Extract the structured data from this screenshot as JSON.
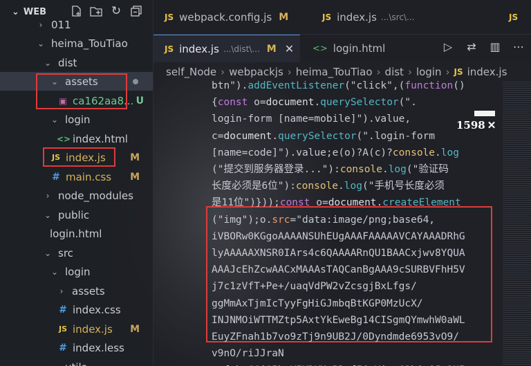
{
  "sidebar": {
    "title": "WEB",
    "tree": [
      {
        "name": "011",
        "chevron": "›",
        "indent": 52,
        "icon": "",
        "status": ""
      },
      {
        "name": "heima_TouTiao",
        "chevron": "⌄",
        "indent": 52,
        "icon": "",
        "status": ""
      },
      {
        "name": "dist",
        "chevron": "⌄",
        "indent": 62,
        "icon": "",
        "status": ""
      },
      {
        "name": "assets",
        "chevron": "⌄",
        "indent": 72,
        "icon": "",
        "status": "dot"
      },
      {
        "name": "ca162aa8...",
        "chevron": "",
        "indent": 82,
        "icon": "img",
        "status": "U"
      },
      {
        "name": "login",
        "chevron": "⌄",
        "indent": 72,
        "icon": "",
        "status": ""
      },
      {
        "name": "index.html",
        "chevron": "",
        "indent": 82,
        "icon": "html",
        "status": ""
      },
      {
        "name": "index.js",
        "chevron": "",
        "indent": 72,
        "icon": "js",
        "status": "M"
      },
      {
        "name": "main.css",
        "chevron": "",
        "indent": 72,
        "icon": "css",
        "status": "M"
      },
      {
        "name": "node_modules",
        "chevron": "›",
        "indent": 62,
        "icon": "",
        "status": ""
      },
      {
        "name": "public",
        "chevron": "⌄",
        "indent": 62,
        "icon": "",
        "status": ""
      },
      {
        "name": "login.html",
        "chevron": "",
        "indent": 72,
        "icon": "",
        "status": ""
      },
      {
        "name": "src",
        "chevron": "⌄",
        "indent": 62,
        "icon": "",
        "status": ""
      },
      {
        "name": "login",
        "chevron": "⌄",
        "indent": 72,
        "icon": "",
        "status": ""
      },
      {
        "name": "assets",
        "chevron": "›",
        "indent": 82,
        "icon": "",
        "status": ""
      },
      {
        "name": "index.css",
        "chevron": "",
        "indent": 82,
        "icon": "css",
        "status": ""
      },
      {
        "name": "index.js",
        "chevron": "",
        "indent": 82,
        "icon": "js",
        "status": "M"
      },
      {
        "name": "index.less",
        "chevron": "",
        "indent": 82,
        "icon": "css",
        "status": ""
      },
      {
        "name": "utils",
        "chevron": "›",
        "indent": 72,
        "icon": "",
        "status": ""
      }
    ]
  },
  "tabs_row1": [
    {
      "label": "webpack.config.js",
      "path": "",
      "flag": "M"
    },
    {
      "label": "index.js",
      "path": "...\\src\\...",
      "flag": ""
    }
  ],
  "tabs_row2": [
    {
      "label": "index.js",
      "path": "...\\dist\\...",
      "flag": "M",
      "close": "✕"
    },
    {
      "label": "login.html",
      "path": "",
      "flag": ""
    }
  ],
  "breadcrumb": [
    "self_Node",
    "webpackjs",
    "heima_TouTiao",
    "dist",
    "login",
    "index.js"
  ],
  "badge": {
    "text": "1598",
    "close": "✕"
  },
  "colors": {
    "highlight": "#e03b3b",
    "accent": "#5b91d8"
  }
}
